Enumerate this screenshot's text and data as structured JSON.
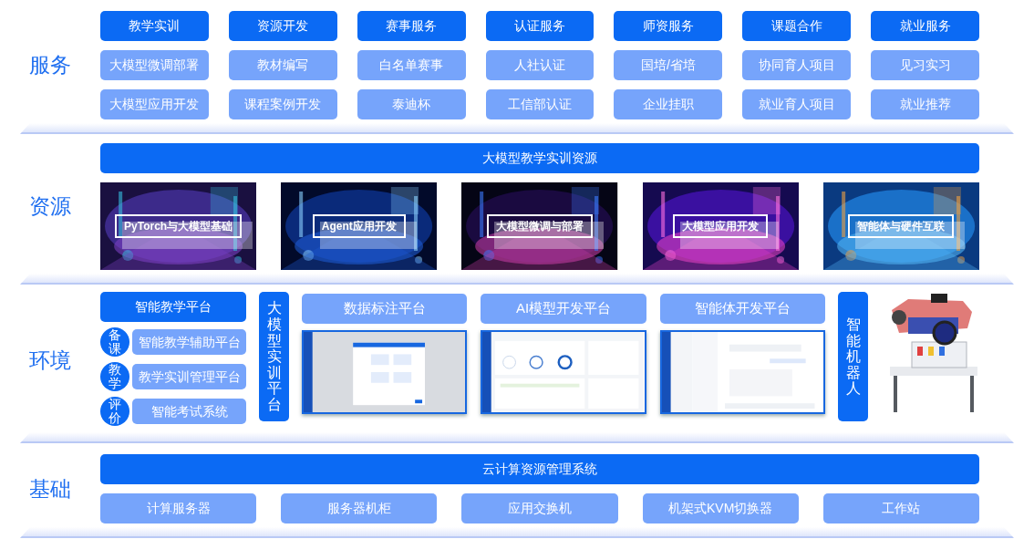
{
  "services": {
    "label": "服务",
    "rows": [
      {
        "kind": "primary",
        "items": [
          "教学实训",
          "资源开发",
          "赛事服务",
          "认证服务",
          "师资服务",
          "课题合作",
          "就业服务"
        ]
      },
      {
        "kind": "secondary",
        "items": [
          "大模型微调部署",
          "教材编写",
          "白名单赛事",
          "人社认证",
          "国培/省培",
          "协同育人项目",
          "见习实习"
        ]
      },
      {
        "kind": "secondary",
        "items": [
          "大模型应用开发",
          "课程案例开发",
          "泰迪杯",
          "工信部认证",
          "企业挂职",
          "就业育人项目",
          "就业推荐"
        ]
      }
    ]
  },
  "resources": {
    "label": "资源",
    "banner": "大模型教学实训资源",
    "courses": [
      {
        "title": "PyTorch与大模型基础"
      },
      {
        "title": "Agent应用开发"
      },
      {
        "title": "大模型微调与部署"
      },
      {
        "title": "大模型应用开发"
      },
      {
        "title": "智能体与硬件互联"
      }
    ]
  },
  "environment": {
    "label": "环境",
    "teaching_platform": {
      "title": "智能教学平台",
      "modules": [
        {
          "badge": "备课",
          "title": "智能教学辅助平台"
        },
        {
          "badge": "教学",
          "title": "教学实训管理平台"
        },
        {
          "badge": "评价",
          "title": "智能考试系统"
        }
      ]
    },
    "training_platform": "大模型实训平台",
    "platforms": [
      {
        "title": "数据标注平台",
        "kind": "dialog"
      },
      {
        "title": "AI模型开发平台",
        "kind": "dashboard"
      },
      {
        "title": "智能体开发平台",
        "kind": "chat"
      }
    ],
    "robot": "智能机器人"
  },
  "infrastructure": {
    "label": "基础",
    "banner": "云计算资源管理系统",
    "items": [
      "计算服务器",
      "服务器机柜",
      "应用交换机",
      "机架式KVM切换器",
      "工作站"
    ]
  }
}
